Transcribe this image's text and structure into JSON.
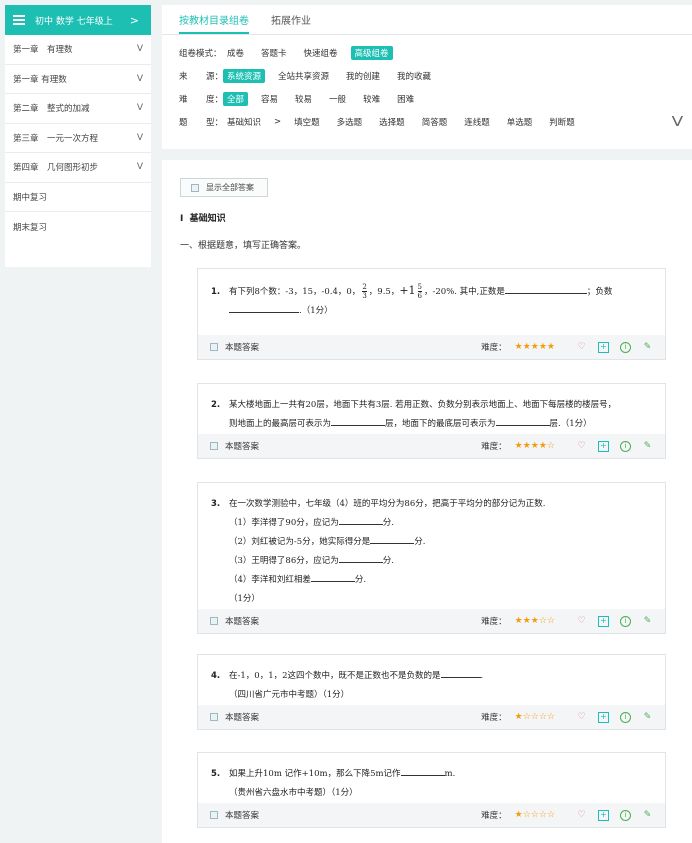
{
  "sidebar": {
    "header": "初中 数学 七年级上",
    "header_arrow": ">",
    "items": [
      {
        "label": "第一章　有理数",
        "chev": "V"
      },
      {
        "label": "第一章 有理数",
        "chev": "V"
      },
      {
        "label": "第二章　整式的加减",
        "chev": "V"
      },
      {
        "label": "第三章　一元一次方程",
        "chev": "V"
      },
      {
        "label": "第四章　几何图形初步",
        "chev": "V"
      },
      {
        "label": "期中复习",
        "chev": ""
      },
      {
        "label": "期末复习",
        "chev": ""
      }
    ]
  },
  "tabs": [
    "按教材目录组卷",
    "拓展作业"
  ],
  "filters": {
    "mode": {
      "key": "组卷模式：",
      "options": [
        "成卷",
        "答题卡",
        "快速组卷",
        "高级组卷"
      ]
    },
    "source": {
      "key1": "来",
      "key2": "源：",
      "options": [
        "系统资源",
        "全站共享资源",
        "我的创建",
        "我的收藏"
      ]
    },
    "difficulty": {
      "key1": "难",
      "key2": "度：",
      "options": [
        "全部",
        "容易",
        "较易",
        "一般",
        "较难",
        "困难"
      ]
    },
    "type": {
      "key1": "题",
      "key2": "型：",
      "options": [
        "基础知识",
        ">",
        "填空题",
        "多选题",
        "选择题",
        "简答题",
        "连线题",
        "单选题",
        "判断题"
      ]
    },
    "expand": "V"
  },
  "main": {
    "show_all": "显示全部答案",
    "section_num": "Ⅰ",
    "section": "基础知识",
    "sub": "一、根据题意，填写正确答案。"
  },
  "foot": {
    "answer": "本题答案",
    "difficulty": "难度："
  },
  "questions": [
    {
      "num": "1.",
      "l1a": "有下列8个数：-3，15，-0.4，0，",
      "f1n": "2",
      "f1d": "3",
      "l1b": "，9.5，",
      "mixed_whole": "+1",
      "f2n": "5",
      "f2d": "6",
      "l1c": "，-20%. 其中,正数是",
      "l1d": "；负数",
      "l2": ".（1分）",
      "stars": "★★★★★"
    },
    {
      "num": "2.",
      "l1": "某大楼地面上一共有20层，地面下共有3层. 若用正数、负数分别表示地面上、地面下每层楼的楼层号，",
      "l2a": "则地面上的最高层可表示为",
      "l2b": "层，地面下的最底层可表示为",
      "l2c": "层.（1分）",
      "stars": "★★★★☆"
    },
    {
      "num": "3.",
      "l1": "在一次数学测验中，七年级（4）班的平均分为86分，把高于平均分的部分记为正数.",
      "s1": "（1）李洋得了90分，应记为",
      "s2": "（2）刘红被记为-5分，她实际得分是",
      "s3": "（3）王明得了86分，应记为",
      "s4": "（4）李洋和刘红相差",
      "unit": "分.",
      "score": "（1分）",
      "stars": "★★★☆☆"
    },
    {
      "num": "4.",
      "l1": "在-1，0，1，2这四个数中，既不是正数也不是负数的是",
      "l1end": ".",
      "l2": "（四川省广元市中考题）（1分）",
      "stars": "★☆☆☆☆"
    },
    {
      "num": "5.",
      "l1": "如果上升10m 记作+10m，那么下降5m记作",
      "l1end": "m.",
      "l2": "（贵州省六盘水市中考题）（1分）",
      "stars": "★☆☆☆☆"
    }
  ]
}
